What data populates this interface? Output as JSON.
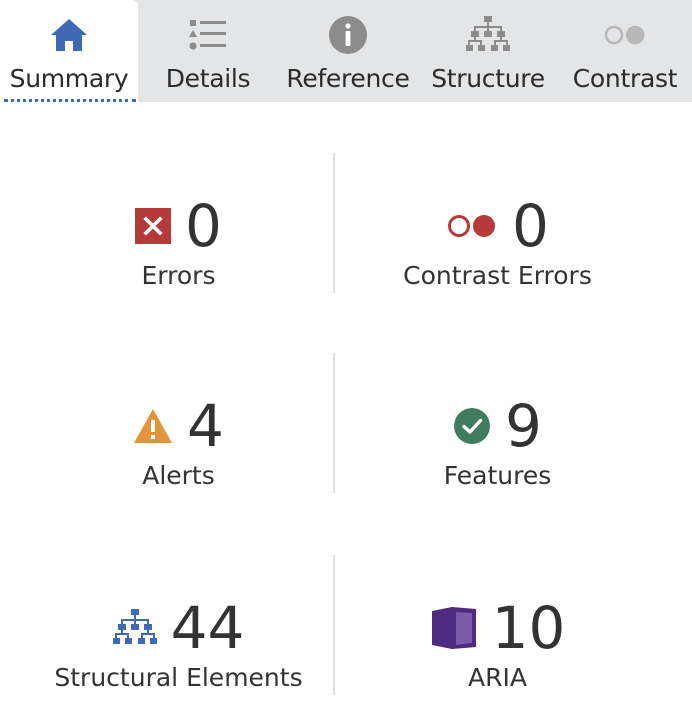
{
  "tabs": [
    {
      "label": "Summary",
      "icon": "home-icon",
      "active": true
    },
    {
      "label": "Details",
      "icon": "list-icon",
      "active": false
    },
    {
      "label": "Reference",
      "icon": "info-icon",
      "active": false
    },
    {
      "label": "Structure",
      "icon": "structure-icon",
      "active": false
    },
    {
      "label": "Contrast",
      "icon": "contrast-icon",
      "active": false
    }
  ],
  "summary": {
    "errors": {
      "count": "0",
      "label": "Errors",
      "icon": "error-x-icon",
      "color": "#b73a3a"
    },
    "contrast_errors": {
      "count": "0",
      "label": "Contrast Errors",
      "icon": "contrast-circles-icon",
      "color": "#b73a3a"
    },
    "alerts": {
      "count": "4",
      "label": "Alerts",
      "icon": "alert-triangle-icon",
      "color": "#e2953b"
    },
    "features": {
      "count": "9",
      "label": "Features",
      "icon": "check-circle-icon",
      "color": "#3f7d5e"
    },
    "structural": {
      "count": "44",
      "label": "Structural Elements",
      "icon": "structure-tree-icon",
      "color": "#3f69b4"
    },
    "aria": {
      "count": "10",
      "label": "ARIA",
      "icon": "aria-box-icon",
      "color": "#4e2a80"
    }
  },
  "colors": {
    "accent": "#3f69b4",
    "tab_bg": "#e4e5e7",
    "icon_gray": "#8c8c8c"
  }
}
